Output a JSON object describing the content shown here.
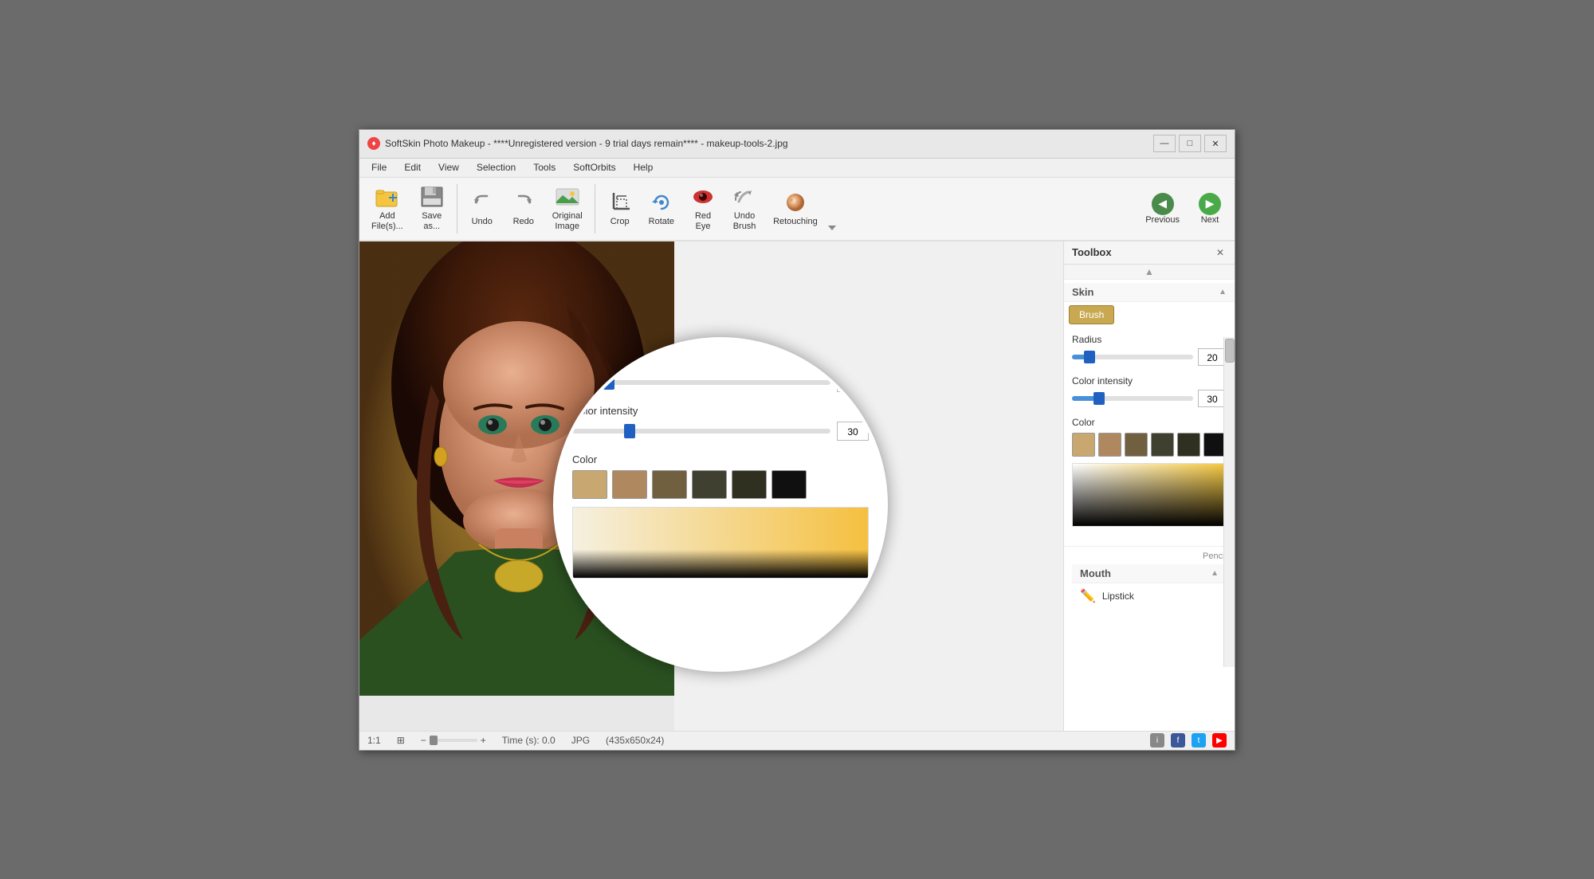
{
  "window": {
    "title": "SoftSkin Photo Makeup - ****Unregistered version - 9 trial days remain**** - makeup-tools-2.jpg",
    "app_icon": "♦",
    "min_btn": "—",
    "max_btn": "□",
    "close_btn": "✕"
  },
  "menu": {
    "items": [
      "File",
      "Edit",
      "View",
      "Selection",
      "Tools",
      "SoftOrbits",
      "Help"
    ]
  },
  "toolbar": {
    "add_files_label": "Add\nFile(s)...",
    "save_as_label": "Save\nas...",
    "undo_label": "Undo",
    "redo_label": "Redo",
    "original_image_label": "Original\nImage",
    "crop_label": "Crop",
    "rotate_label": "Rotate",
    "red_eye_label": "Red\nEye",
    "undo_brush_label": "Undo\nBrush",
    "retouching_label": "Retouching"
  },
  "nav": {
    "previous_label": "Previous",
    "next_label": "Next"
  },
  "toolbox": {
    "title": "Toolbox",
    "close_btn": "✕",
    "skin_label": "Skin",
    "brush_tab": "Brush",
    "radius_label": "Radius",
    "radius_value": "20",
    "radius_pct": 15,
    "color_intensity_label": "Color intensity",
    "color_intensity_value": "30",
    "color_intensity_pct": 22,
    "color_label": "Color",
    "swatches": [
      {
        "color": "#c8a870"
      },
      {
        "color": "#b08860"
      },
      {
        "color": "#706040"
      },
      {
        "color": "#404030"
      },
      {
        "color": "#303020"
      },
      {
        "color": "#101010"
      }
    ],
    "mouth_label": "Mouth",
    "lipstick_label": "Lipstick"
  },
  "status": {
    "zoom": "1:1",
    "view_icon": "⊞",
    "time_label": "Time (s):",
    "time_value": "0.0",
    "format": "JPG",
    "size": "(435x650x24)",
    "icons": [
      "i",
      "f",
      "t",
      "▶"
    ]
  }
}
